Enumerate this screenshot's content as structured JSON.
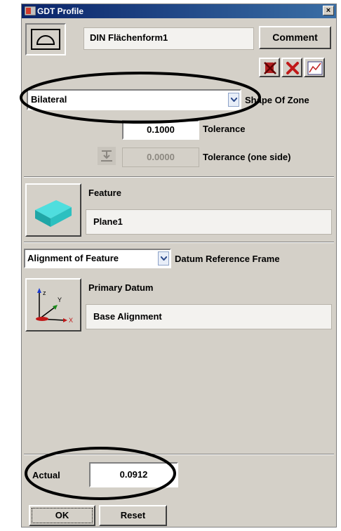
{
  "window": {
    "title": "GDT Profile",
    "close_glyph": "×"
  },
  "header": {
    "profile_name": "DIN Flächenform1",
    "comment_label": "Comment",
    "icons": [
      "surface-profile-symbol-icon",
      "delete-red-icon",
      "cancel-red-icon",
      "graph-icon"
    ]
  },
  "zone": {
    "shape_value": "Bilateral",
    "shape_label": "Shape Of Zone",
    "tolerance_value": "0.1000",
    "tolerance_label": "Tolerance",
    "one_side_value": "0.0000",
    "one_side_label": "Tolerance (one side)"
  },
  "feature": {
    "label": "Feature",
    "value": "Plane1",
    "icon": "plane-feature-icon"
  },
  "datum": {
    "alignment_value": "Alignment of Feature",
    "frame_label": "Datum Reference Frame",
    "primary_label": "Primary Datum",
    "primary_value": "Base Alignment",
    "icon": "coordinate-axes-icon",
    "axis_labels": {
      "z": "z",
      "y": "Y",
      "x": "X"
    }
  },
  "actual": {
    "label": "Actual",
    "value": "0.0912"
  },
  "footer": {
    "ok_label": "OK",
    "reset_label": "Reset"
  },
  "colors": {
    "title_bar": "#0a246a",
    "annotation_ellipse": "#000000",
    "feature_teal": "#2fc6c6"
  }
}
